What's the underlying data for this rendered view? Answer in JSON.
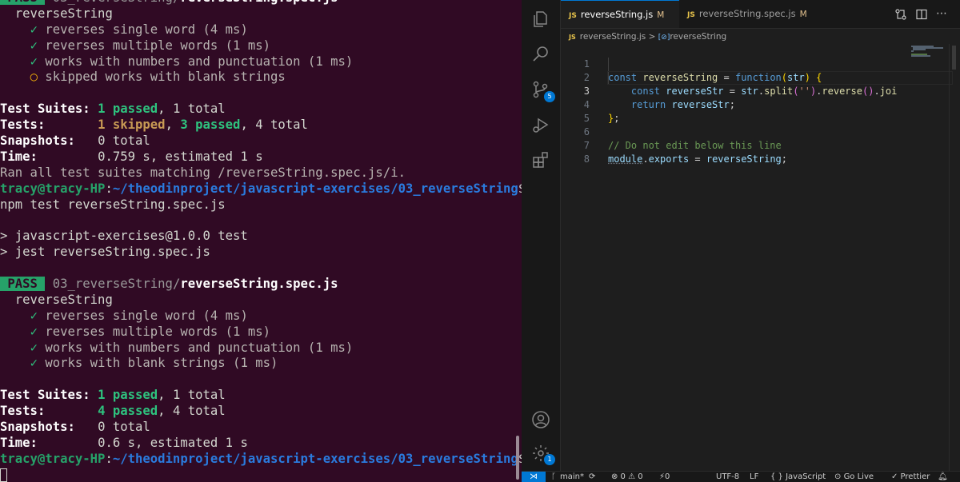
{
  "terminal": {
    "spec_file_prefix": "03_reverseString/",
    "spec_file_name": "reverseString.spec.js",
    "pass_badge": " PASS ",
    "describe_name": "reverseString",
    "first_run_tests": [
      {
        "mark": "✓",
        "text": "reverses single word (4 ms)"
      },
      {
        "mark": "✓",
        "text": "reverses multiple words (1 ms)"
      },
      {
        "mark": "✓",
        "text": "works with numbers and punctuation (1 ms)"
      },
      {
        "mark": "○",
        "text": "skipped works with blank strings"
      }
    ],
    "second_run_tests": [
      {
        "mark": "✓",
        "text": "reverses single word (4 ms)"
      },
      {
        "mark": "✓",
        "text": "reverses multiple words (1 ms)"
      },
      {
        "mark": "✓",
        "text": "works with numbers and punctuation (1 ms)"
      },
      {
        "mark": "✓",
        "text": "works with blank strings (1 ms)"
      }
    ],
    "summary_labels": {
      "suites": "Test Suites: ",
      "tests": "Tests:       ",
      "snapshots": "Snapshots:   ",
      "time": "Time:        "
    },
    "first_summary": {
      "suites_passed": "1 passed",
      "suites_rest": ", 1 total",
      "tests_skipped": "1 skipped",
      "tests_sep": ", ",
      "tests_passed": "3 passed",
      "tests_rest": ", 4 total",
      "snapshots": "0 total",
      "time": "0.759 s, estimated 1 s"
    },
    "ran_all": "Ran all test suites matching /reverseString.spec.js/i.",
    "prompt_user": "tracy@tracy-HP",
    "prompt_sep": ":",
    "prompt_path": "~/theodinproject/javascript-exercises/03_reverseString",
    "prompt_dollar": "$",
    "command": "npm test reverseString.spec.js",
    "npm_line1": "> javascript-exercises@1.0.0 test",
    "npm_line2": "> jest reverseString.spec.js",
    "second_summary": {
      "suites_passed": "1 passed",
      "suites_rest": ", 1 total",
      "tests_passed": "4 passed",
      "tests_rest": ", 4 total",
      "snapshots": "0 total",
      "time": "0.6 s, estimated 1 s"
    }
  },
  "vscode": {
    "activity": {
      "scm_badge": "5",
      "manage_badge": "1"
    },
    "tabs": [
      {
        "icon": "JS",
        "label": "reverseString.js",
        "mod": "M"
      },
      {
        "icon": "JS",
        "label": "reverseString.spec.js",
        "mod": "M"
      }
    ],
    "breadcrumb": {
      "file": "reverseString.js",
      "sep": " > ",
      "symbol_icon": "[⊘]",
      "symbol": "reverseString"
    },
    "code": {
      "line_numbers": [
        "1",
        "2",
        "3",
        "4",
        "5",
        "6",
        "7",
        "8"
      ],
      "l1": {
        "kw": "const ",
        "name": "reverseString",
        "eq": " = ",
        "fn": "function",
        "open": "(",
        "arg": "str",
        "close": ")",
        "brace": " {"
      },
      "l2": {
        "kw": "const ",
        "name": "reverseStr",
        "eq": " = ",
        "obj": "str",
        "dot1": ".",
        "m1": "split",
        "p1o": "(",
        "s": "''",
        "p1c": ")",
        "dot2": ".",
        "m2": "reverse",
        "p2": "()",
        "dot3": ".",
        "m3": "joi"
      },
      "l3": {
        "kw": "return ",
        "name": "reverseStr",
        "semi": ";"
      },
      "l4": {
        "brace": "}",
        "semi": ";"
      },
      "l6": {
        "comment": "// Do not edit below this line"
      },
      "l7": {
        "obj": "module",
        "dot": ".",
        "prop": "exports",
        "eq": " = ",
        "val": "reverseString",
        "semi": ";"
      }
    },
    "status": {
      "remote": "⋊",
      "branch": "main*",
      "sync": "⟳",
      "problems": "⊗ 0 ⚠ 0",
      "ports": "⚡0",
      "encoding": "UTF-8",
      "eol": "LF",
      "language": "{ } JavaScript",
      "golive": "Go Live",
      "prettier": "✓ Prettier"
    }
  }
}
